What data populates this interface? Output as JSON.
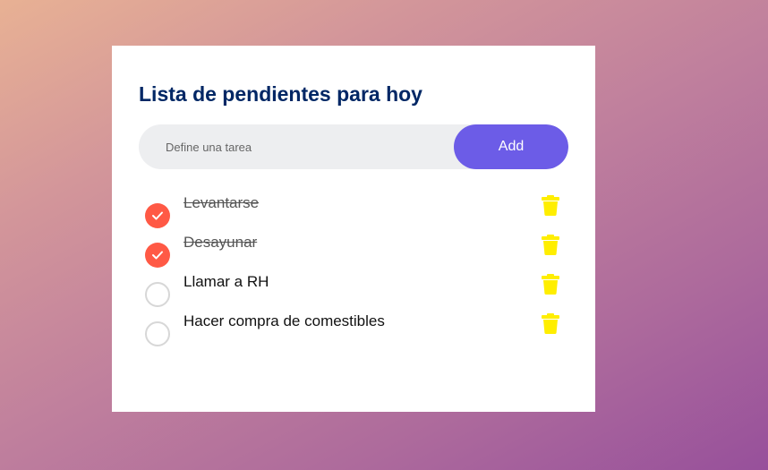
{
  "app": {
    "title": "Lista de pendientes para hoy"
  },
  "input": {
    "placeholder": "Define una tarea",
    "value": ""
  },
  "add_button": {
    "label": "Add"
  },
  "tasks": [
    {
      "label": "Levantarse",
      "done": true
    },
    {
      "label": "Desayunar",
      "done": true
    },
    {
      "label": "Llamar a RH",
      "done": false
    },
    {
      "label": "Hacer compra de comestibles",
      "done": false
    }
  ],
  "colors": {
    "title": "#002765",
    "accent": "#6c5ce7",
    "checked": "#ff5945",
    "trash": "#ffee00",
    "input_bg": "#edeef0"
  },
  "icons": {
    "check": "check-icon",
    "delete": "trash-icon"
  }
}
